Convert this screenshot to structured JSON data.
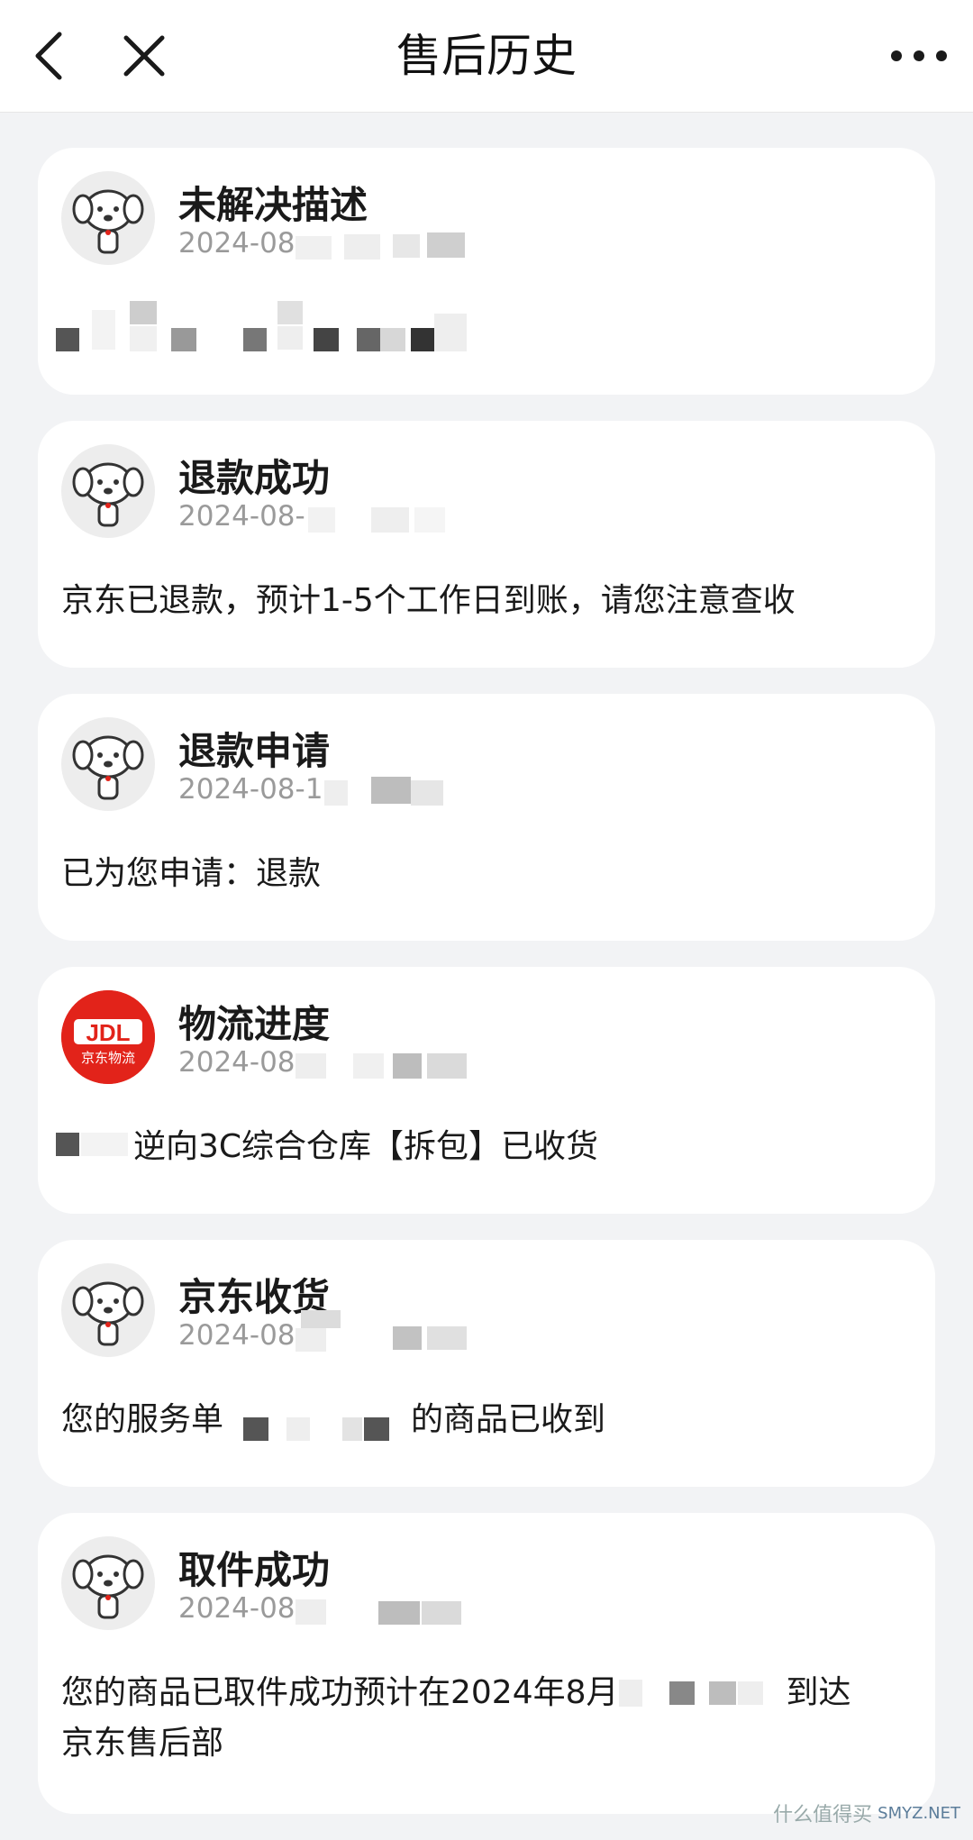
{
  "header": {
    "title": "售后历史",
    "back_icon": "chevron-left-icon",
    "close_icon": "close-icon",
    "more_icon": "more-dots-icon"
  },
  "cards": [
    {
      "title": "未解决描述",
      "date": "2024-08",
      "desc": ""
    },
    {
      "title": "退款成功",
      "date": "2024-08-",
      "desc": "京东已退款，预计1-5个工作日到账，请您注意查收"
    },
    {
      "title": "退款申请",
      "date": "2024-08-1",
      "desc": "已为您申请：退款"
    },
    {
      "title": "物流进度",
      "date": "2024-08",
      "desc": "逆向3C综合仓库【拆包】已收货",
      "avatar": "jdl-logo"
    },
    {
      "title": "京东收货",
      "date": "2024-08",
      "desc_before": "您的服务单",
      "desc_after": "的商品已收到"
    },
    {
      "title": "取件成功",
      "date": "2024-08",
      "desc_before": "您的商品已取件成功预计在2024年8月",
      "desc_after": "到达",
      "desc_line2": "京东售后部"
    }
  ],
  "logo_text": {
    "jdl": "JDL",
    "jdl_sub": "京东物流"
  },
  "watermark": {
    "text": "什么值得买",
    "sub": "SMYZ.NET"
  },
  "colors": {
    "accent_red": "#e2231a",
    "card_bg": "#ffffff",
    "page_bg": "#f2f3f5",
    "muted": "#9a9a9a"
  }
}
